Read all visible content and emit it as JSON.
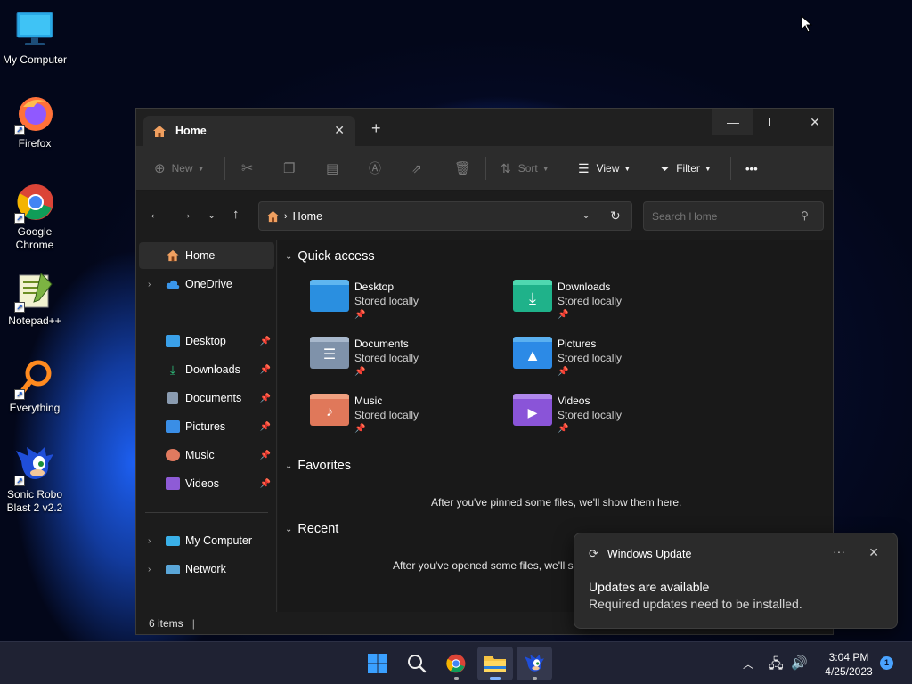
{
  "desktop": {
    "icons": [
      {
        "label": "My Computer",
        "icon": "monitor-icon"
      },
      {
        "label": "Firefox",
        "icon": "firefox-icon"
      },
      {
        "label": "Google Chrome",
        "icon": "chrome-icon"
      },
      {
        "label": "Notepad++",
        "icon": "notepadpp-icon"
      },
      {
        "label": "Everything",
        "icon": "everything-icon"
      },
      {
        "label": "Sonic Robo Blast 2 v2.2",
        "icon": "sonic-icon"
      }
    ]
  },
  "explorer": {
    "tab_title": "Home",
    "new_tab": "+",
    "toolbar": {
      "new_label": "New",
      "sort_label": "Sort",
      "view_label": "View",
      "filter_label": "Filter",
      "more_label": "•••"
    },
    "address": {
      "crumb": "Home"
    },
    "search": {
      "placeholder": "Search Home"
    },
    "sidebar": {
      "home": "Home",
      "onedrive": "OneDrive",
      "pinned": [
        {
          "label": "Desktop",
          "color": "#3aa0e8"
        },
        {
          "label": "Downloads",
          "color": "#2ec27e"
        },
        {
          "label": "Documents",
          "color": "#8a9bb0"
        },
        {
          "label": "Pictures",
          "color": "#3a8ee6"
        },
        {
          "label": "Music",
          "color": "#e07a5f"
        },
        {
          "label": "Videos",
          "color": "#8e5bd6"
        }
      ],
      "my_computer": "My Computer",
      "network": "Network"
    },
    "quick_access": {
      "title": "Quick access",
      "items": [
        {
          "name": "Desktop",
          "sub": "Stored locally",
          "color": "#2a8fe0"
        },
        {
          "name": "Downloads",
          "sub": "Stored locally",
          "color": "#1fb28a"
        },
        {
          "name": "Documents",
          "sub": "Stored locally",
          "color": "#7f92aa"
        },
        {
          "name": "Pictures",
          "sub": "Stored locally",
          "color": "#2c8ae6"
        },
        {
          "name": "Music",
          "sub": "Stored locally",
          "color": "#e0785a"
        },
        {
          "name": "Videos",
          "sub": "Stored locally",
          "color": "#8a54d8"
        }
      ]
    },
    "favorites": {
      "title": "Favorites",
      "empty": "After you've pinned some files, we'll show them here."
    },
    "recent": {
      "title": "Recent",
      "empty": "After you've opened some files, we'll sh"
    },
    "status": {
      "items": "6 items"
    }
  },
  "toast": {
    "app": "Windows Update",
    "more": "···",
    "title": "Updates are available",
    "body": "Required updates need to be installed."
  },
  "taskbar": {
    "clock_time": "3:04 PM",
    "clock_date": "4/25/2023",
    "notification_count": "1"
  }
}
